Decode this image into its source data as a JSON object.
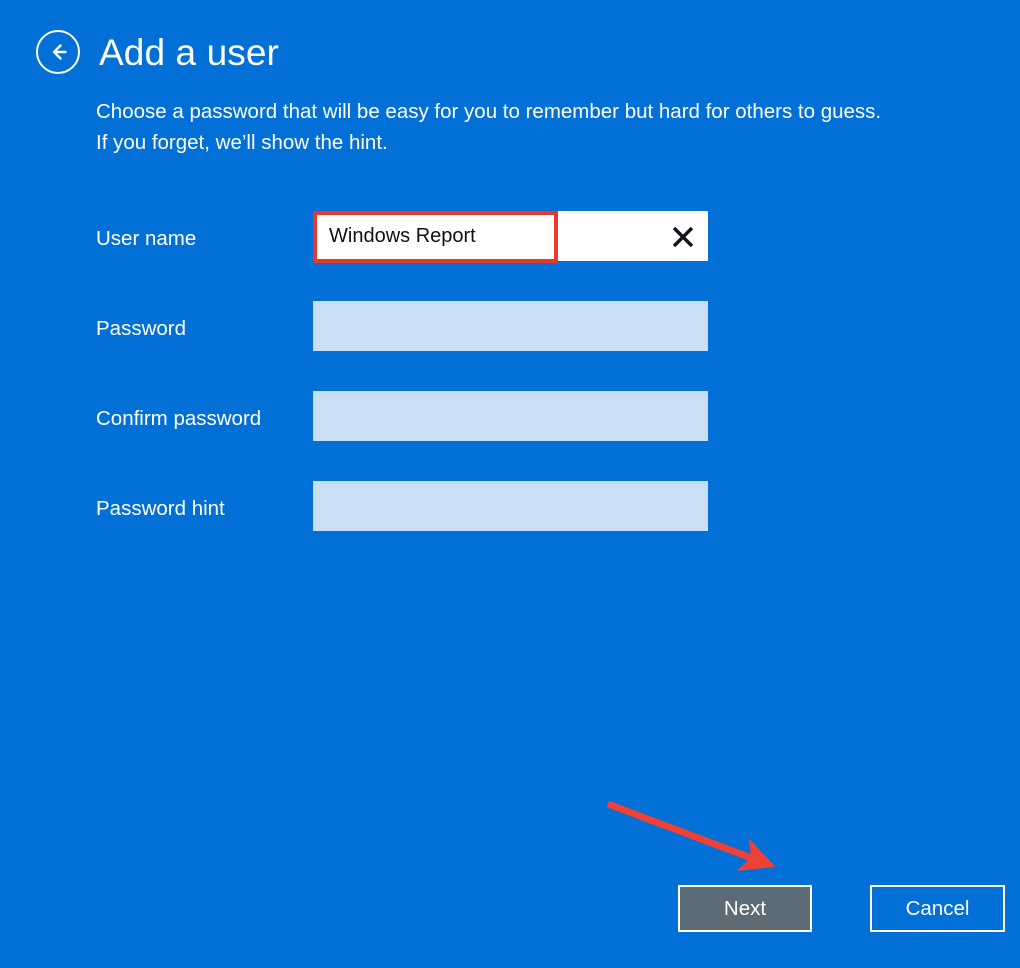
{
  "window": {
    "background_color": "#0270d7",
    "accent_color": "#ffffff"
  },
  "header": {
    "back_icon": "back-arrow-circle-icon",
    "title": "Add a user"
  },
  "description": {
    "line1": "Choose a password that will be easy for you to remember but hard for others to guess.",
    "line2": "If you forget, we’ll show the hint."
  },
  "form": {
    "fields": [
      {
        "label": "User name",
        "value": "Windows Report",
        "placeholder": "",
        "type": "text",
        "state": "active",
        "has_clear_button": true,
        "clear_icon": "close-x-icon",
        "highlighted": true
      },
      {
        "label": "Password",
        "value": "",
        "placeholder": "",
        "type": "password",
        "state": "inactive",
        "has_clear_button": false,
        "clear_icon": "",
        "highlighted": false
      },
      {
        "label": "Confirm password",
        "value": "",
        "placeholder": "",
        "type": "password",
        "state": "inactive",
        "has_clear_button": false,
        "clear_icon": "",
        "highlighted": false
      },
      {
        "label": "Password hint",
        "value": "",
        "placeholder": "",
        "type": "text",
        "state": "inactive",
        "has_clear_button": false,
        "clear_icon": "",
        "highlighted": false
      }
    ]
  },
  "footer": {
    "next_label": "Next",
    "cancel_label": "Cancel"
  },
  "annotations": {
    "highlight_box_color": "#e8392b",
    "arrow_color": "#ef4136",
    "arrow_target": "Next",
    "highlight_target": "User name"
  }
}
